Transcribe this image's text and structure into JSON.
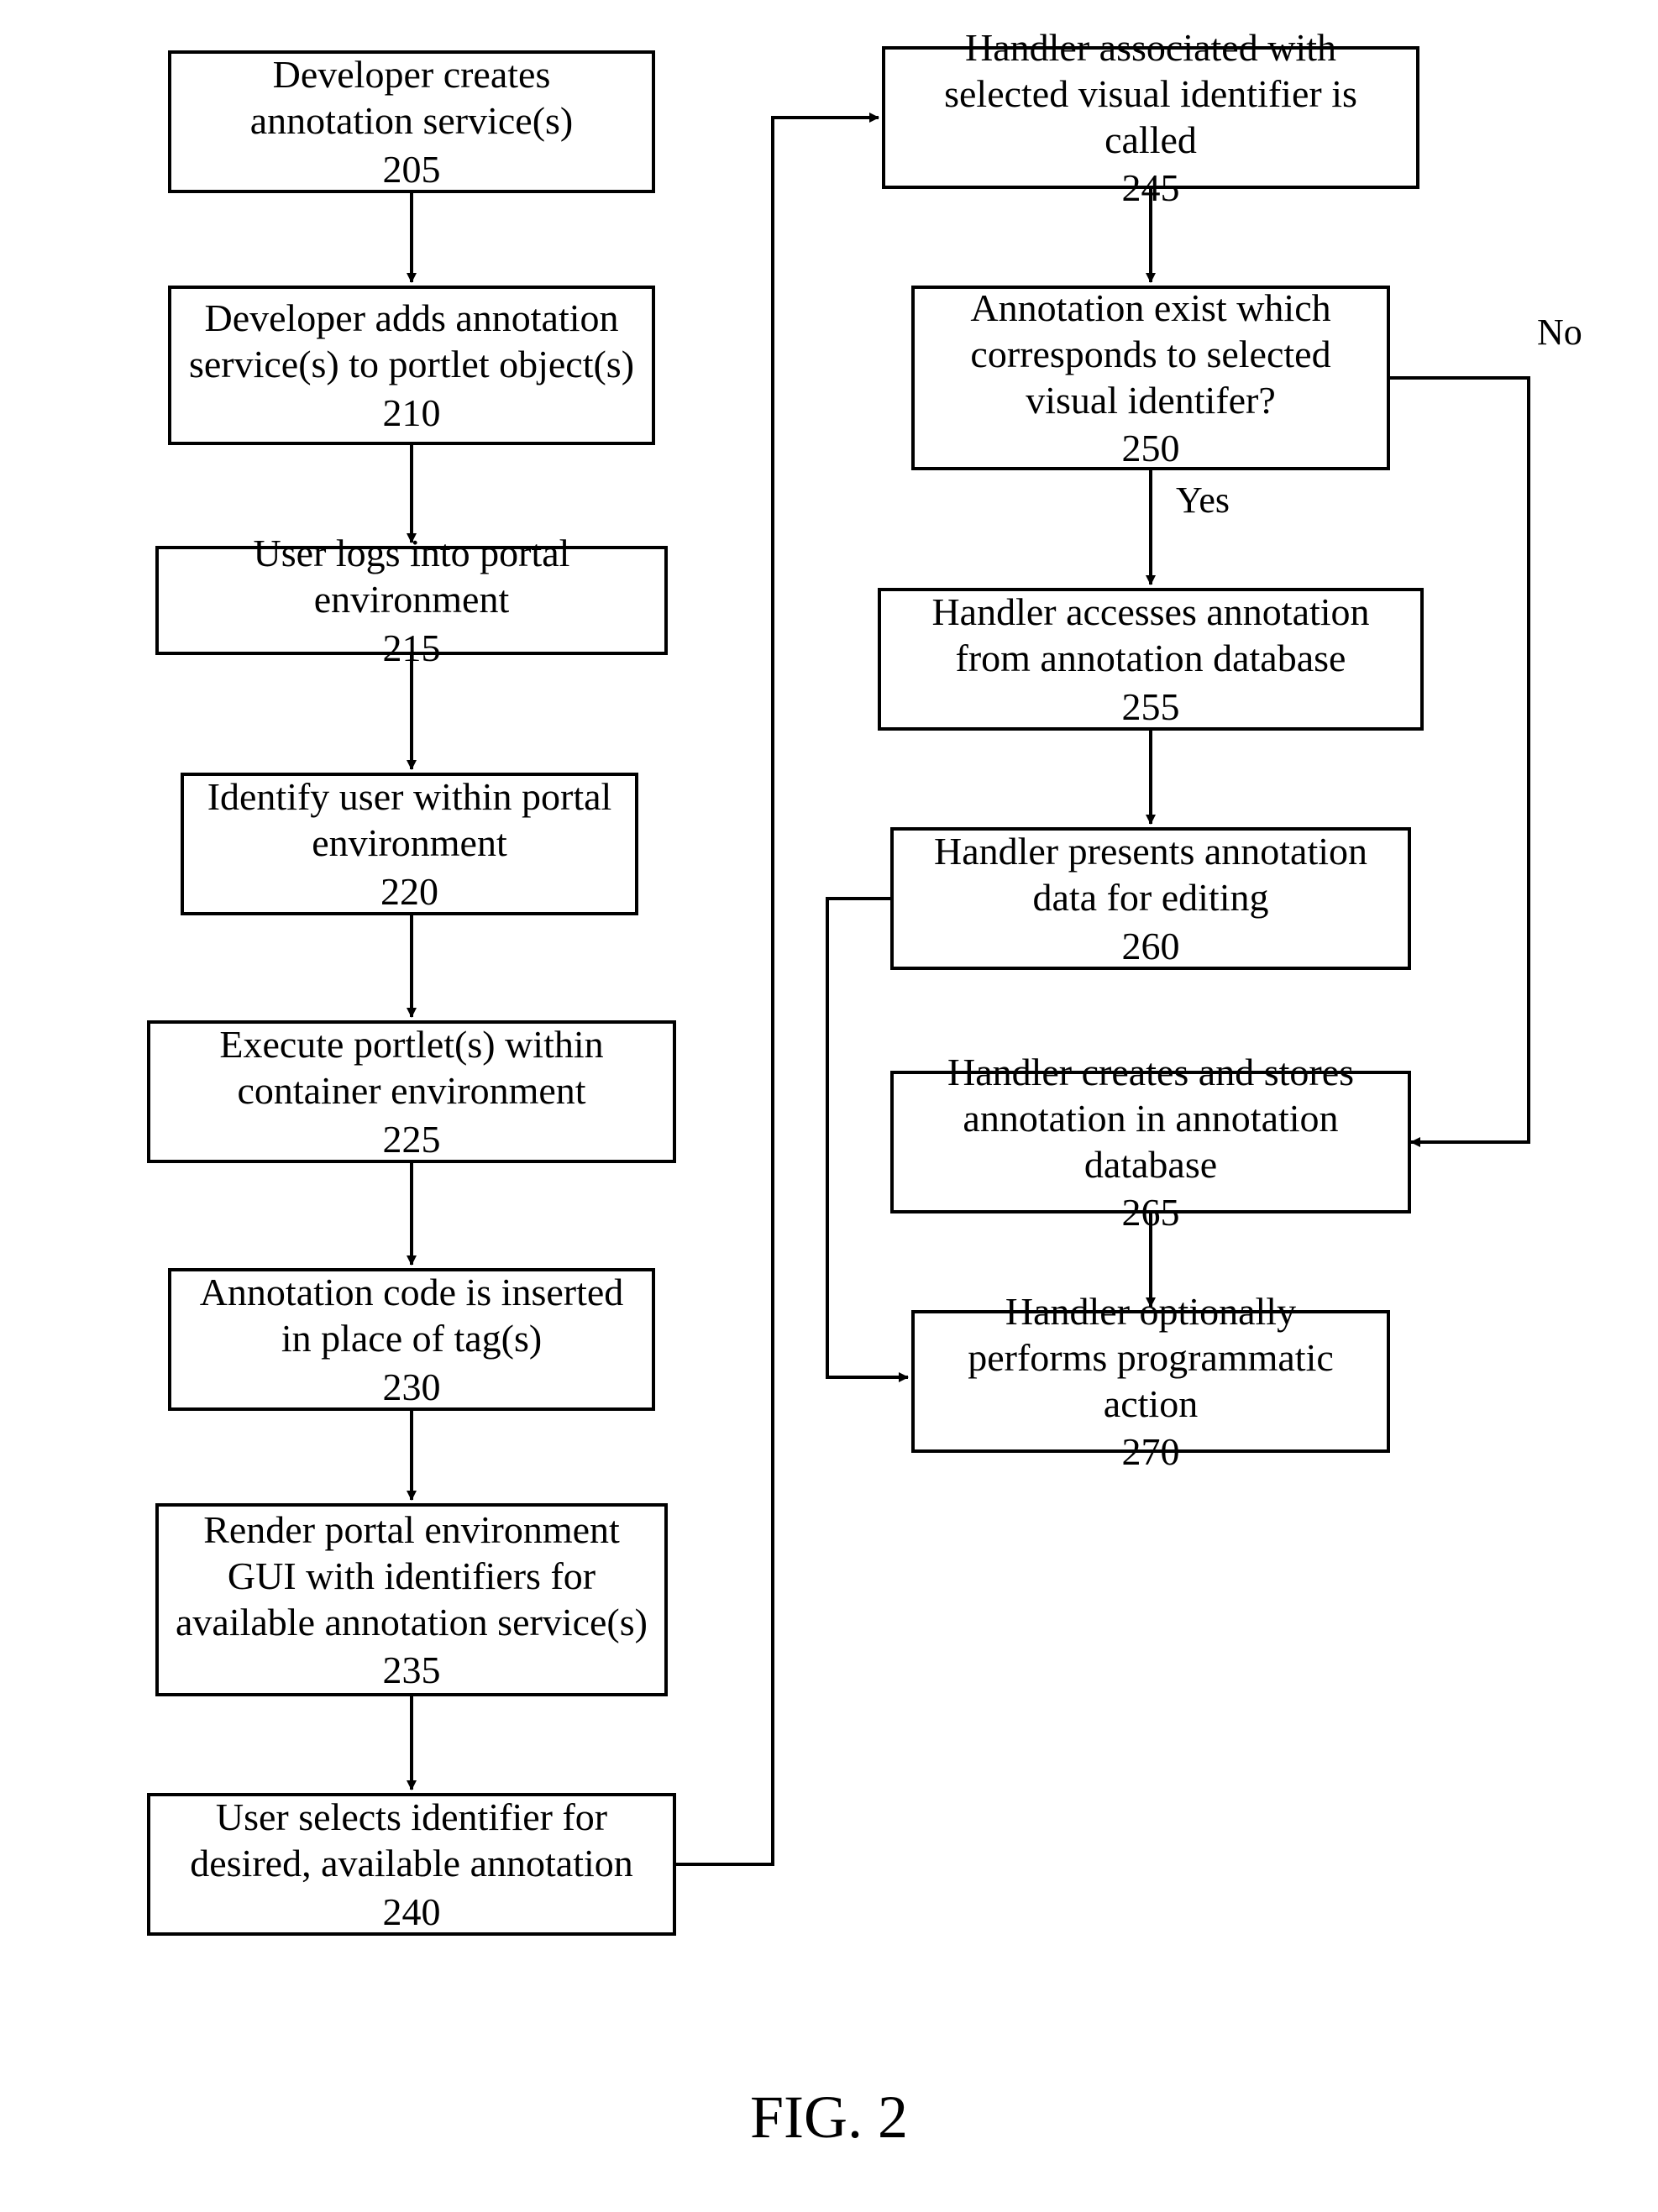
{
  "figure_label": "FIG. 2",
  "nodes": {
    "n205": {
      "text": "Developer creates annotation service(s)",
      "num": "205"
    },
    "n210": {
      "text": "Developer adds annotation service(s) to portlet object(s)",
      "num": "210"
    },
    "n215": {
      "text": "User logs into portal environment",
      "num": "215"
    },
    "n220": {
      "text": "Identify user within portal environment",
      "num": "220"
    },
    "n225": {
      "text": "Execute portlet(s) within container environment",
      "num": "225"
    },
    "n230": {
      "text": "Annotation code is inserted in place of tag(s)",
      "num": "230"
    },
    "n235": {
      "text": "Render portal environment GUI with identifiers for available annotation service(s)",
      "num": "235"
    },
    "n240": {
      "text": "User selects identifier for desired, available annotation",
      "num": "240"
    },
    "n245": {
      "text": "Handler associated with selected visual identifier is called",
      "num": "245"
    },
    "n250": {
      "text": "Annotation exist which corresponds to selected visual identifer?",
      "num": "250"
    },
    "n255": {
      "text": "Handler accesses annotation from annotation database",
      "num": "255"
    },
    "n260": {
      "text": "Handler presents annotation data for editing",
      "num": "260"
    },
    "n265": {
      "text": "Handler creates and stores annotation in annotation database",
      "num": "265"
    },
    "n270": {
      "text": "Handler optionally performs programmatic action",
      "num": "270"
    }
  },
  "labels": {
    "yes": "Yes",
    "no": "No"
  }
}
